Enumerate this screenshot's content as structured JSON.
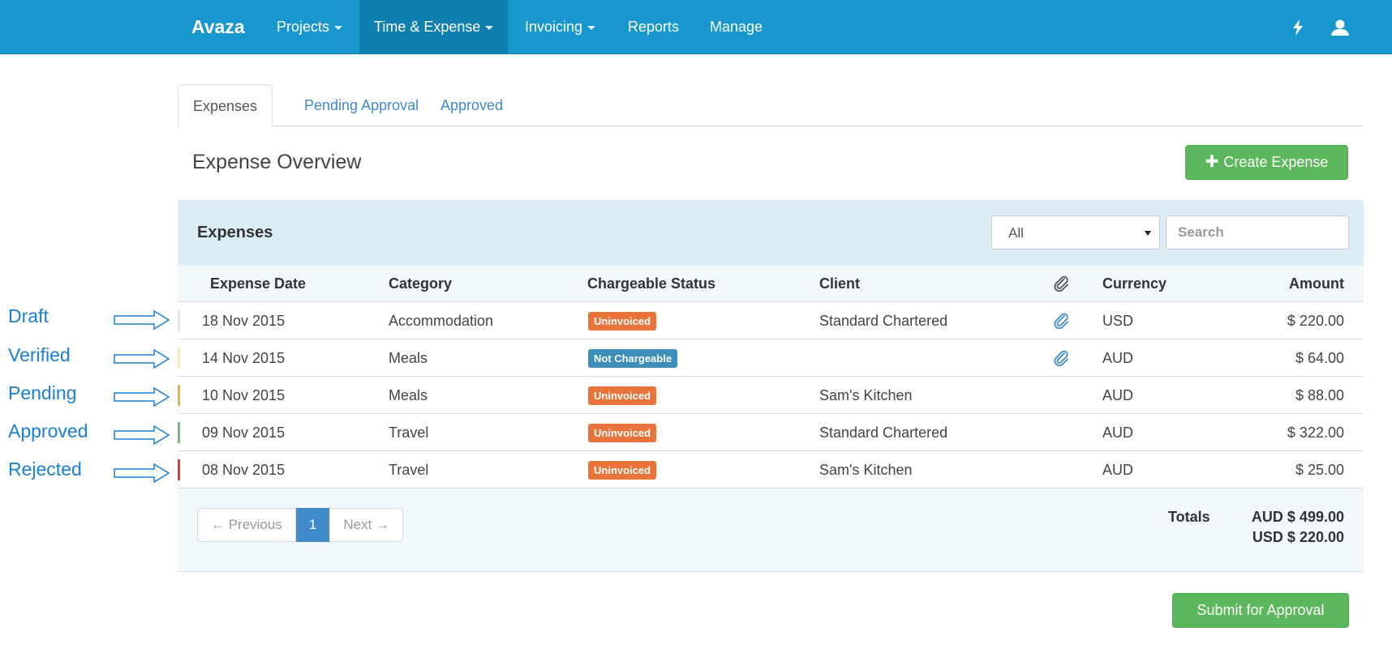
{
  "navbar": {
    "brand": "Avaza",
    "items": [
      {
        "label": "Projects",
        "dropdown": true
      },
      {
        "label": "Time & Expense",
        "dropdown": true,
        "active": true
      },
      {
        "label": "Invoicing",
        "dropdown": true
      },
      {
        "label": "Reports",
        "dropdown": false
      },
      {
        "label": "Manage",
        "dropdown": false
      }
    ],
    "icons": [
      "lightning-icon",
      "user-icon"
    ]
  },
  "tabs": [
    "Expenses",
    "Pending Approval",
    "Approved"
  ],
  "page": {
    "title": "Expense Overview",
    "create_button": "Create Expense",
    "submit_button": "Submit for Approval"
  },
  "panel": {
    "title": "Expenses",
    "filter_value": "All",
    "search_placeholder": "Search"
  },
  "table": {
    "columns": [
      "Expense Date",
      "Category",
      "Chargeable Status",
      "Client",
      "attachment-icon",
      "Currency",
      "Amount"
    ],
    "rows": [
      {
        "status": "Draft",
        "status_color": "#e5e5e5",
        "date": "18 Nov 2015",
        "category": "Accommodation",
        "chargeable": "Uninvoiced",
        "chargeable_color": "#e8743b",
        "client": "Standard Chartered",
        "attachment": true,
        "currency": "USD",
        "amount": "$ 220.00"
      },
      {
        "status": "Verified",
        "status_color": "#fbe9a6",
        "date": "14 Nov 2015",
        "category": "Meals",
        "chargeable": "Not Chargeable",
        "chargeable_color": "#3d8eb9",
        "client": "",
        "attachment": true,
        "currency": "AUD",
        "amount": "$ 64.00"
      },
      {
        "status": "Pending",
        "status_color": "#f0b429",
        "date": "10 Nov 2015",
        "category": "Meals",
        "chargeable": "Uninvoiced",
        "chargeable_color": "#e8743b",
        "client": "Sam's Kitchen",
        "attachment": false,
        "currency": "AUD",
        "amount": "$ 88.00"
      },
      {
        "status": "Approved",
        "status_color": "#6cc070",
        "date": "09 Nov 2015",
        "category": "Travel",
        "chargeable": "Uninvoiced",
        "chargeable_color": "#e8743b",
        "client": "Standard Chartered",
        "attachment": false,
        "currency": "AUD",
        "amount": "$ 322.00"
      },
      {
        "status": "Rejected",
        "status_color": "#e03c31",
        "date": "08 Nov 2015",
        "category": "Travel",
        "chargeable": "Uninvoiced",
        "chargeable_color": "#e8743b",
        "client": "Sam's Kitchen",
        "attachment": false,
        "currency": "AUD",
        "amount": "$ 25.00"
      }
    ]
  },
  "pagination": {
    "previous": "← Previous",
    "current": "1",
    "next": "Next →"
  },
  "totals": {
    "label": "Totals",
    "lines": [
      "AUD $ 499.00",
      "USD $ 220.00"
    ]
  },
  "annotations": [
    "Draft",
    "Verified",
    "Pending",
    "Approved",
    "Rejected"
  ],
  "colors": {
    "navbar": "#1797cd",
    "accent": "#428bca",
    "success": "#5cb85c",
    "annotation": "#1a7fd6"
  }
}
